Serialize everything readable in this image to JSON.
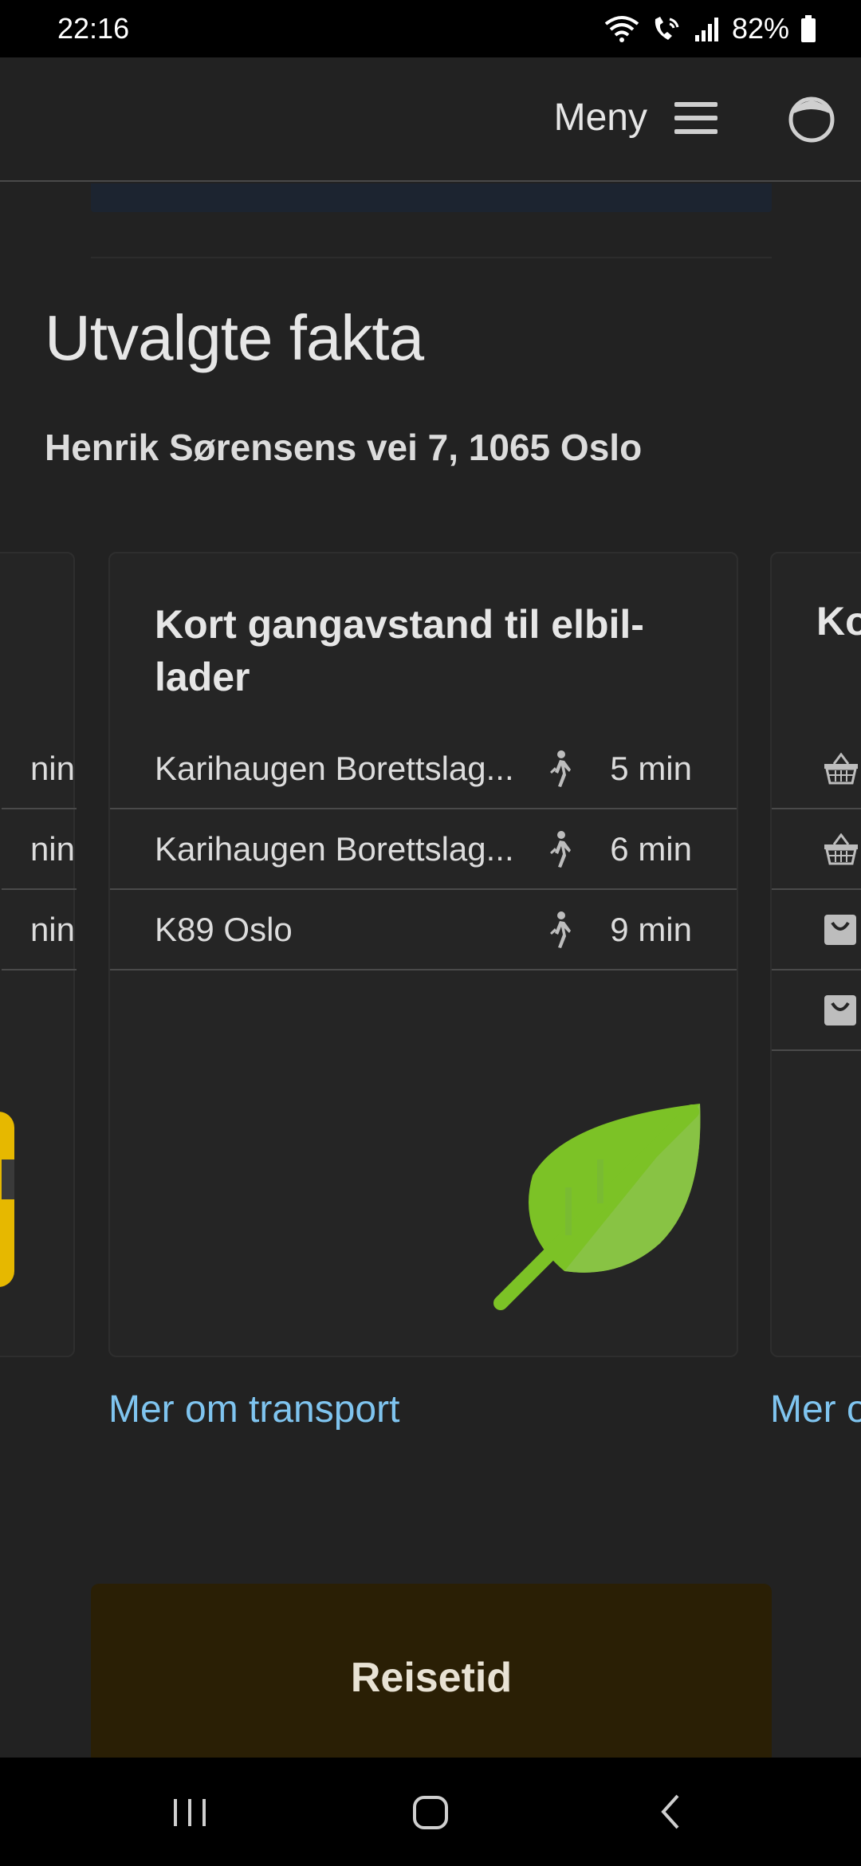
{
  "status_bar": {
    "time": "22:16",
    "battery": "82%",
    "icons": [
      "wifi-icon",
      "wifi-calling-icon",
      "signal-icon",
      "battery-icon"
    ]
  },
  "header": {
    "menu_label": "Meny",
    "menu_icon": "hamburger-icon",
    "profile_icon": "profile-icon"
  },
  "section": {
    "title": "Utvalgte fakta",
    "address": "Henrik Sørensens vei 7, 1065 Oslo"
  },
  "left_card": {
    "row_fragments": [
      "nin",
      "nin",
      "nin"
    ]
  },
  "main_card": {
    "title": "Kort gangavstand til elbil-lader",
    "rows": [
      {
        "name": "Karihaugen Borettslag...",
        "icon": "walking-icon",
        "time": "5 min"
      },
      {
        "name": "Karihaugen Borettslag...",
        "icon": "walking-icon",
        "time": "6 min"
      },
      {
        "name": "K89 Oslo",
        "icon": "walking-icon",
        "time": "9 min"
      }
    ],
    "illustration": "leaf-icon",
    "link": "Mer om transport"
  },
  "right_card": {
    "title_fragment": "Ko",
    "row_icons": [
      "basket-icon",
      "basket-icon",
      "shopping-bag-icon",
      "shopping-bag-icon"
    ],
    "link_fragment": "Mer o"
  },
  "travel_card": {
    "title": "Reisetid"
  },
  "colors": {
    "background": "#222222",
    "link": "#7fc4ef",
    "leaf_light": "#8bc34a",
    "leaf_dark": "#76c022",
    "travel_card_bg": "#2a1f05"
  },
  "nav_bar": {
    "buttons": [
      "recent-apps-icon",
      "home-icon",
      "back-icon"
    ]
  }
}
